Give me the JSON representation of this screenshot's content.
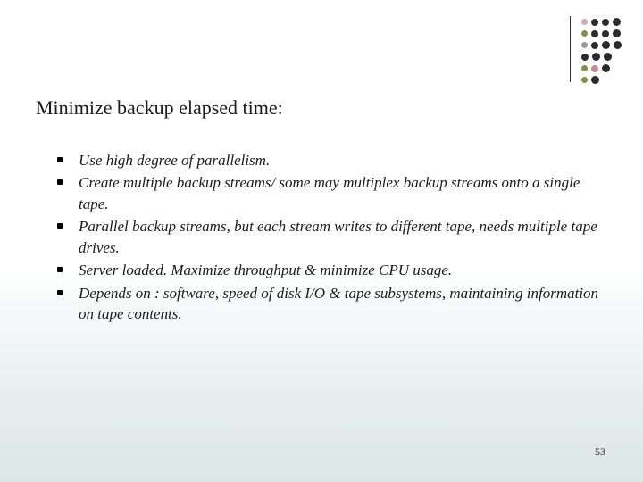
{
  "title": "Minimize backup elapsed time:",
  "bullets": [
    "Use high degree of parallelism.",
    "Create multiple backup streams/  some may multiplex backup streams onto a single tape.",
    "Parallel backup streams, but each stream writes to different tape, needs multiple tape drives.",
    "Server loaded. Maximize throughput & minimize CPU usage.",
    "Depends on : software, speed of disk I/O & tape subsystems, maintaining information on tape contents."
  ],
  "page_number": "53"
}
